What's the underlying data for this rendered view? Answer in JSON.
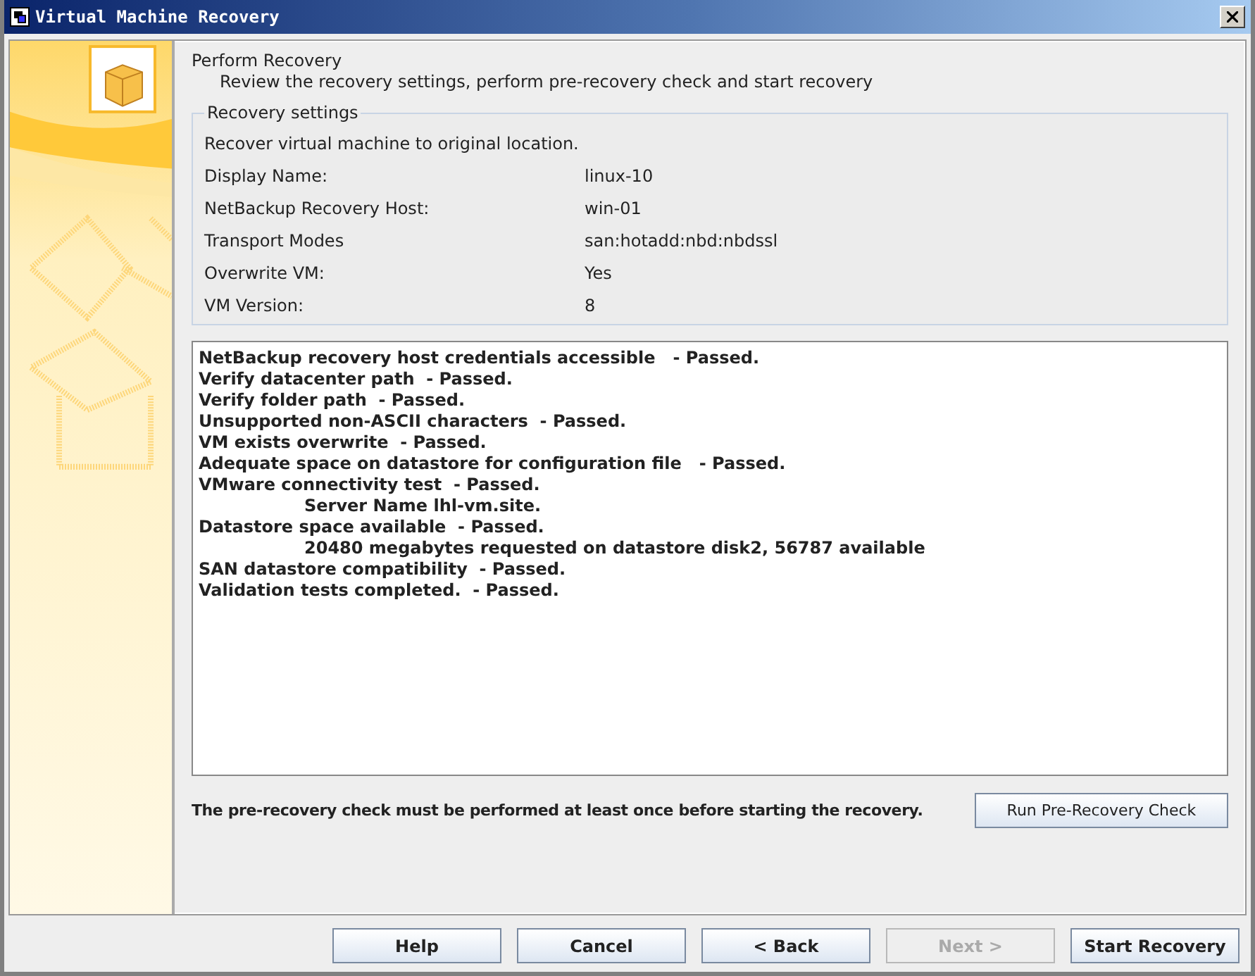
{
  "window": {
    "title": "Virtual Machine Recovery"
  },
  "header": {
    "title": "Perform Recovery",
    "subtitle": "Review the recovery settings, perform pre-recovery check and start recovery"
  },
  "recovery_settings": {
    "legend": "Recovery settings",
    "summary": "Recover virtual machine to original location.",
    "rows": [
      {
        "label": "Display Name:",
        "value": "linux-10"
      },
      {
        "label": "NetBackup Recovery Host:",
        "value": "win-01"
      },
      {
        "label": "Transport Modes",
        "value": "san:hotadd:nbd:nbdssl"
      },
      {
        "label": "Overwrite VM:",
        "value": "Yes"
      },
      {
        "label": "VM Version:",
        "value": "8"
      }
    ]
  },
  "log": [
    {
      "kind": "result",
      "text": "NetBackup recovery host credentials accessible   - Passed."
    },
    {
      "kind": "result",
      "text": "Verify datacenter path  - Passed."
    },
    {
      "kind": "result",
      "text": "Verify folder path  - Passed."
    },
    {
      "kind": "result",
      "text": "Unsupported non-ASCII characters  - Passed."
    },
    {
      "kind": "result",
      "text": "VM exists overwrite  - Passed."
    },
    {
      "kind": "result",
      "text": "Adequate space on datastore for configuration file   - Passed."
    },
    {
      "kind": "result",
      "text": "VMware connectivity test  - Passed."
    },
    {
      "kind": "detail",
      "text": "Server Name lhl-vm.site."
    },
    {
      "kind": "result",
      "text": "Datastore space available  - Passed."
    },
    {
      "kind": "detail",
      "text": "20480 megabytes requested on datastore disk2, 56787 available"
    },
    {
      "kind": "result",
      "text": "SAN datastore compatibility  - Passed."
    },
    {
      "kind": "result",
      "text": "Validation tests completed.  - Passed."
    }
  ],
  "check_note": "The pre-recovery check must be performed at least once before starting the recovery.",
  "check_button": "Run Pre-Recovery Check",
  "buttons": [
    {
      "label": "Help",
      "disabled": false
    },
    {
      "label": "Cancel",
      "disabled": false
    },
    {
      "label": "< Back",
      "disabled": false
    },
    {
      "label": "Next >",
      "disabled": true
    },
    {
      "label": "Start Recovery",
      "disabled": false
    }
  ]
}
